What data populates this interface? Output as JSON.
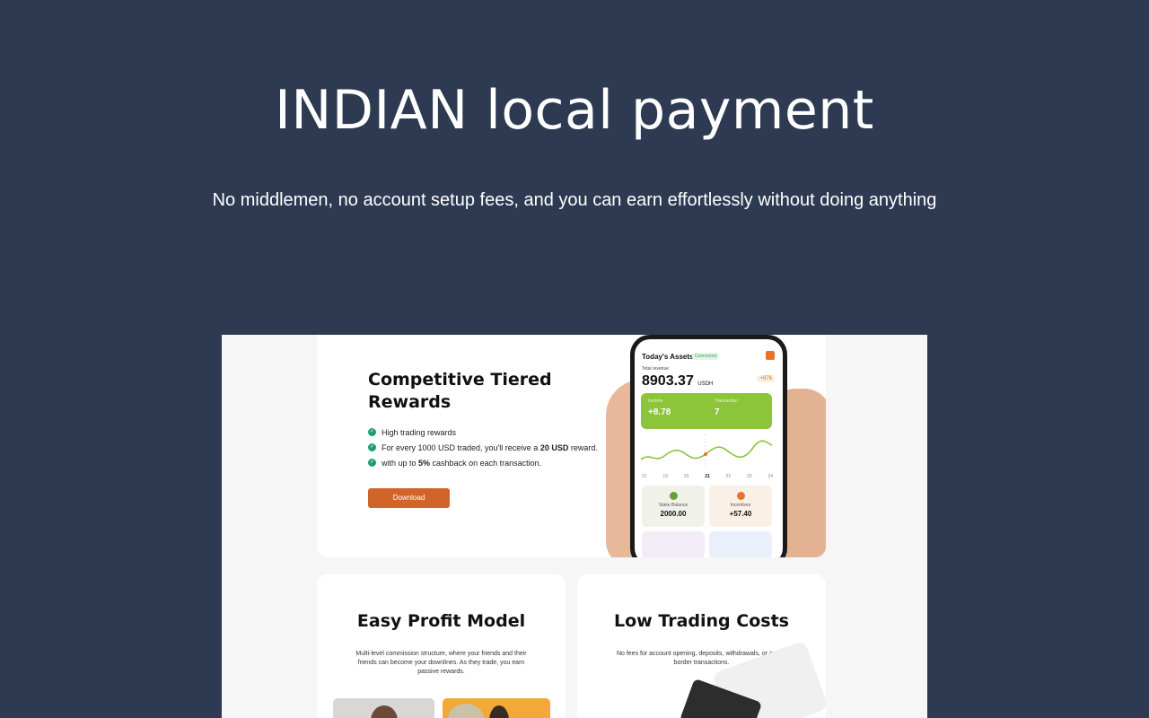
{
  "hero": {
    "title": "INDIAN local payment",
    "subtitle": "No middlemen, no account setup fees, and you can earn effortlessly without doing anything"
  },
  "screenshot": {
    "rewards_card": {
      "title": "Competitive Tiered Rewards",
      "bullets": [
        {
          "text": "High trading rewards"
        },
        {
          "pre": "For every 1000 USD traded, you'll receive a ",
          "bold": "20 USD",
          "post": " reward."
        },
        {
          "pre": "with up to ",
          "bold": "5%",
          "post": " cashback on each transaction."
        }
      ],
      "download_label": "Download"
    },
    "phone": {
      "header": "Today's Assets",
      "status": "Connected",
      "revenue_label": "Total revenue",
      "revenue": "8903.37",
      "unit": "USDH",
      "badge": "+876",
      "income_label": "Income",
      "income_value": "+8.78",
      "transaction_label": "Transaction",
      "transaction_value": "7",
      "days": [
        "22",
        "19",
        "20",
        "21",
        "22",
        "23",
        "24"
      ],
      "stake_label": "Stake Balance",
      "stake_value": "2000.00",
      "incentives_label": "Incentives",
      "incentives_value": "+57.40"
    },
    "profit_card": {
      "title": "Easy Profit Model",
      "text": "Multi-level commission structure, where your friends and their friends can become your downlines. As they trade, you earn passive rewards."
    },
    "costs_card": {
      "title": "Low Trading Costs",
      "text": "No fees for account opening, deposits, withdrawals, or cross-border transactions."
    }
  }
}
